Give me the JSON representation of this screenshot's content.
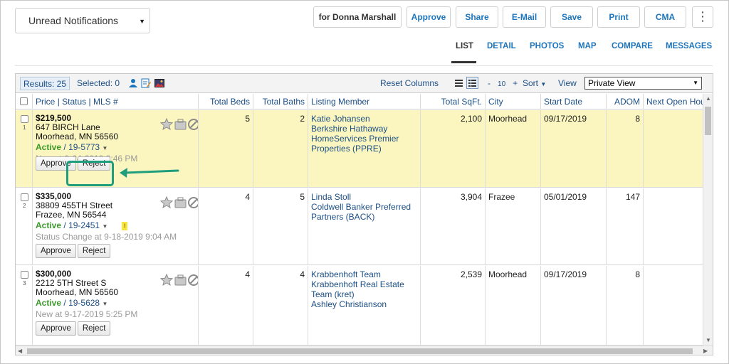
{
  "filter": {
    "selected": "Unread Notifications"
  },
  "toolbar": {
    "client": "for Donna Marshall",
    "approve": "Approve",
    "share": "Share",
    "email": "E-Mail",
    "save": "Save",
    "print": "Print",
    "cma": "CMA"
  },
  "tabs": [
    {
      "label": "LIST",
      "active": true
    },
    {
      "label": "DETAIL"
    },
    {
      "label": "PHOTOS"
    },
    {
      "label": "MAP"
    },
    {
      "label": "COMPARE"
    },
    {
      "label": "MESSAGES"
    }
  ],
  "grid_toolbar": {
    "results": "Results: 25",
    "selected": "Selected: 0",
    "reset_columns": "Reset Columns",
    "pager_minus": "-",
    "page_size": "10",
    "pager_plus": "+",
    "sort": "Sort",
    "view_label": "View",
    "view_value": "Private View"
  },
  "columns": {
    "price": "Price",
    "status": "Status",
    "mls": "MLS #",
    "sep": "|",
    "beds": "Total Beds",
    "baths": "Total Baths",
    "member": "Listing Member",
    "sqft": "Total SqFt.",
    "city": "City",
    "start": "Start Date",
    "adom": "ADOM",
    "open": "Next Open Hou"
  },
  "rows": [
    {
      "num": "1",
      "price": "$219,500",
      "street": "647 BIRCH Lane",
      "citystate": "Moorhead, MN 56560",
      "status": "Active",
      "slash": "/",
      "mls": "19-5773",
      "note": "New at 9-24-2019 3:46 PM",
      "approve": "Approve",
      "reject": "Reject",
      "beds": "5",
      "baths": "2",
      "member": [
        "Katie Johansen",
        "Berkshire Hathaway",
        "HomeServices Premier",
        "Properties (PPRE)"
      ],
      "sqft": "2,100",
      "city": "Moorhead",
      "start": "09/17/2019",
      "adom": "8",
      "highlighted": true
    },
    {
      "num": "2",
      "price": "$335,000",
      "street": "38809 455TH Street",
      "citystate": "Frazee, MN 56544",
      "status": "Active",
      "slash": "/",
      "mls": "19-2451",
      "flag": "!",
      "note": "Status Change at 9-18-2019 9:04 AM",
      "approve": "Approve",
      "reject": "Reject",
      "beds": "4",
      "baths": "5",
      "member": [
        "Linda Stoll",
        "Coldwell Banker Preferred",
        "Partners (BACK)"
      ],
      "sqft": "3,904",
      "city": "Frazee",
      "start": "05/01/2019",
      "adom": "147"
    },
    {
      "num": "3",
      "price": "$300,000",
      "street": "2212 5TH Street S",
      "citystate": "Moorhead, MN 56560",
      "status": "Active",
      "slash": "/",
      "mls": "19-5628",
      "note": "New at 9-17-2019 5:25 PM",
      "approve": "Approve",
      "reject": "Reject",
      "beds": "4",
      "baths": "4",
      "member": [
        "Krabbenhoft Team",
        "Krabbenhoft Real Estate",
        "Team (kret)",
        "Ashley Christianson"
      ],
      "sqft": "2,539",
      "city": "Moorhead",
      "start": "09/17/2019",
      "adom": "8"
    }
  ],
  "colors": {
    "link": "#1c75bc",
    "active_status": "#3a9a2a",
    "highlight_row": "#fbf6bf",
    "annotation": "#1f9e7e"
  },
  "icons": [
    "chevron-down-icon",
    "more-vertical-icon",
    "person-icon",
    "notes-icon",
    "photo-icon",
    "list-view-icon",
    "grid-view-icon",
    "star-icon",
    "briefcase-icon",
    "ban-icon",
    "edit-note-icon",
    "scroll-arrow-icon"
  ]
}
